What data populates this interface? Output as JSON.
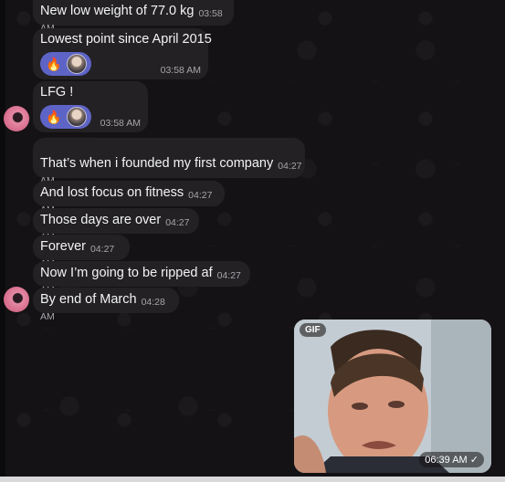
{
  "messages": [
    {
      "text": "New low weight of 77.0 kg",
      "time": "03:58 AM"
    },
    {
      "text": "Lowest point since April 2015",
      "time": "03:58 AM",
      "reactions": [
        "🔥"
      ]
    },
    {
      "text": "LFG !",
      "time": "03:58 AM",
      "reactions": [
        "🔥"
      ]
    },
    {
      "text": "That’s when i founded my first company",
      "time": "04:27 AM"
    },
    {
      "text": "And lost focus on fitness",
      "time": "04:27 AM"
    },
    {
      "text": "Those days are over",
      "time": "04:27 AM"
    },
    {
      "text": "Forever",
      "time": "04:27 AM"
    },
    {
      "text": "Now I’m going to be ripped af",
      "time": "04:27 AM"
    },
    {
      "text": "By end of March",
      "time": "04:28 AM"
    }
  ],
  "gif_message": {
    "badge": "GIF",
    "time": "06:39 AM",
    "status_icon": "✓"
  },
  "colors": {
    "bubble": "#232124",
    "reaction": "#5e64c6",
    "avatar": "#e58aa5"
  }
}
